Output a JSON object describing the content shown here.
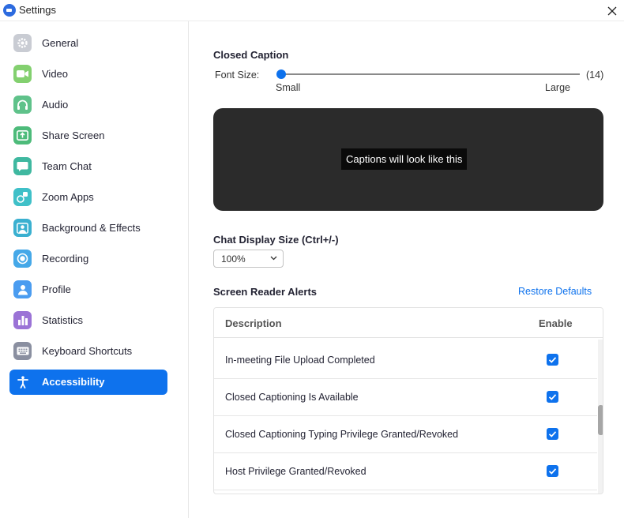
{
  "window": {
    "title": "Settings"
  },
  "sidebar": {
    "items": [
      {
        "label": "General",
        "icon": "gear-icon",
        "color": "#c9ccd3",
        "active": false
      },
      {
        "label": "Video",
        "icon": "video-camera-icon",
        "color": "#83d06f",
        "active": false
      },
      {
        "label": "Audio",
        "icon": "headphones-icon",
        "color": "#5fc28a",
        "active": false
      },
      {
        "label": "Share Screen",
        "icon": "share-screen-icon",
        "color": "#4dbb7a",
        "active": false
      },
      {
        "label": "Team Chat",
        "icon": "chat-bubble-icon",
        "color": "#3fb8a0",
        "active": false
      },
      {
        "label": "Zoom Apps",
        "icon": "apps-icon",
        "color": "#3fc0c8",
        "active": false
      },
      {
        "label": "Background & Effects",
        "icon": "person-background-icon",
        "color": "#3ab0d0",
        "active": false
      },
      {
        "label": "Recording",
        "icon": "record-icon",
        "color": "#45a8e8",
        "active": false
      },
      {
        "label": "Profile",
        "icon": "profile-icon",
        "color": "#4a9cf0",
        "active": false
      },
      {
        "label": "Statistics",
        "icon": "bar-chart-icon",
        "color": "#9b73d6",
        "active": false
      },
      {
        "label": "Keyboard Shortcuts",
        "icon": "keyboard-icon",
        "color": "#8a8fa0",
        "active": false
      },
      {
        "label": "Accessibility",
        "icon": "accessibility-icon",
        "color": "#0e72ed",
        "active": true
      }
    ]
  },
  "closed_caption": {
    "title": "Closed Caption",
    "font_size_label": "Font Size:",
    "min_label": "Small",
    "max_label": "Large",
    "value_display": "(14)",
    "slider_level": 0,
    "preview_text": "Captions will look like this"
  },
  "chat_display": {
    "title": "Chat Display Size (Ctrl+/-)",
    "selected": "100%"
  },
  "screen_reader": {
    "title": "Screen Reader Alerts",
    "restore_label": "Restore Defaults",
    "columns": [
      "Description",
      "Enable"
    ],
    "rows": [
      {
        "description": "In-meeting File Upload Completed",
        "enabled": true
      },
      {
        "description": "Closed Captioning Is Available",
        "enabled": true
      },
      {
        "description": "Closed Captioning Typing Privilege Granted/Revoked",
        "enabled": true
      },
      {
        "description": "Host Privilege Granted/Revoked",
        "enabled": true
      }
    ]
  },
  "colors": {
    "accent": "#0e72ed",
    "preview_bg": "#2b2b2b"
  }
}
